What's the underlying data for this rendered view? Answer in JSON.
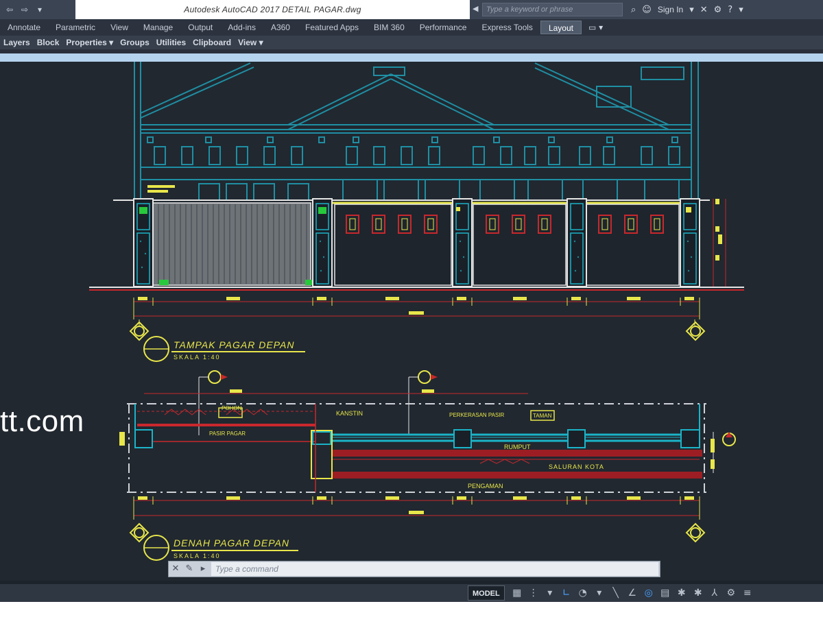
{
  "app": {
    "document_title": "Autodesk AutoCAD 2017   DETAIL PAGAR.dwg",
    "search_placeholder": "Type a keyword or phrase",
    "sign_in_label": "Sign In"
  },
  "quick_access": {
    "icons": [
      "back-arrow-icon",
      "forward-arrow-icon",
      "dropdown-arrow-icon"
    ]
  },
  "ribbon": {
    "tabs": [
      "Annotate",
      "Parametric",
      "View",
      "Manage",
      "Output",
      "Add-ins",
      "A360",
      "Featured Apps",
      "BIM 360",
      "Performance",
      "Express Tools",
      "Layout"
    ],
    "active_tab": "Layout"
  },
  "panels": {
    "items": [
      "Layers",
      "Block",
      "Properties ▾",
      "Groups",
      "Utilities",
      "Clipboard",
      "View ▾"
    ]
  },
  "drawing": {
    "elevation_title": "TAMPAK PAGAR DEPAN",
    "plan_title": "DENAH PAGAR DEPAN",
    "scale_label": "SKALA 1:40",
    "labels": {
      "kanstin": "KANSTIN",
      "pohon": "POHON",
      "pasir_pagar": "PASIR PAGAR",
      "perkerasan": "PERKERASAN PASIR",
      "taman": "TAMAN",
      "rumput": "RUMPUT",
      "saluran": "SALURAN KOTA",
      "pengaman": "PENGAMAN",
      "total_width": "13000"
    },
    "colors": {
      "background": "#212830",
      "cyan": "#1bb4c8",
      "yellow": "#e8e64a",
      "red": "#c8282c",
      "white": "#e6e6e6",
      "green": "#28c83c"
    }
  },
  "watermark": "tt.com",
  "command_line": {
    "placeholder": "Type a command"
  },
  "status": {
    "model_label": "MODEL"
  }
}
